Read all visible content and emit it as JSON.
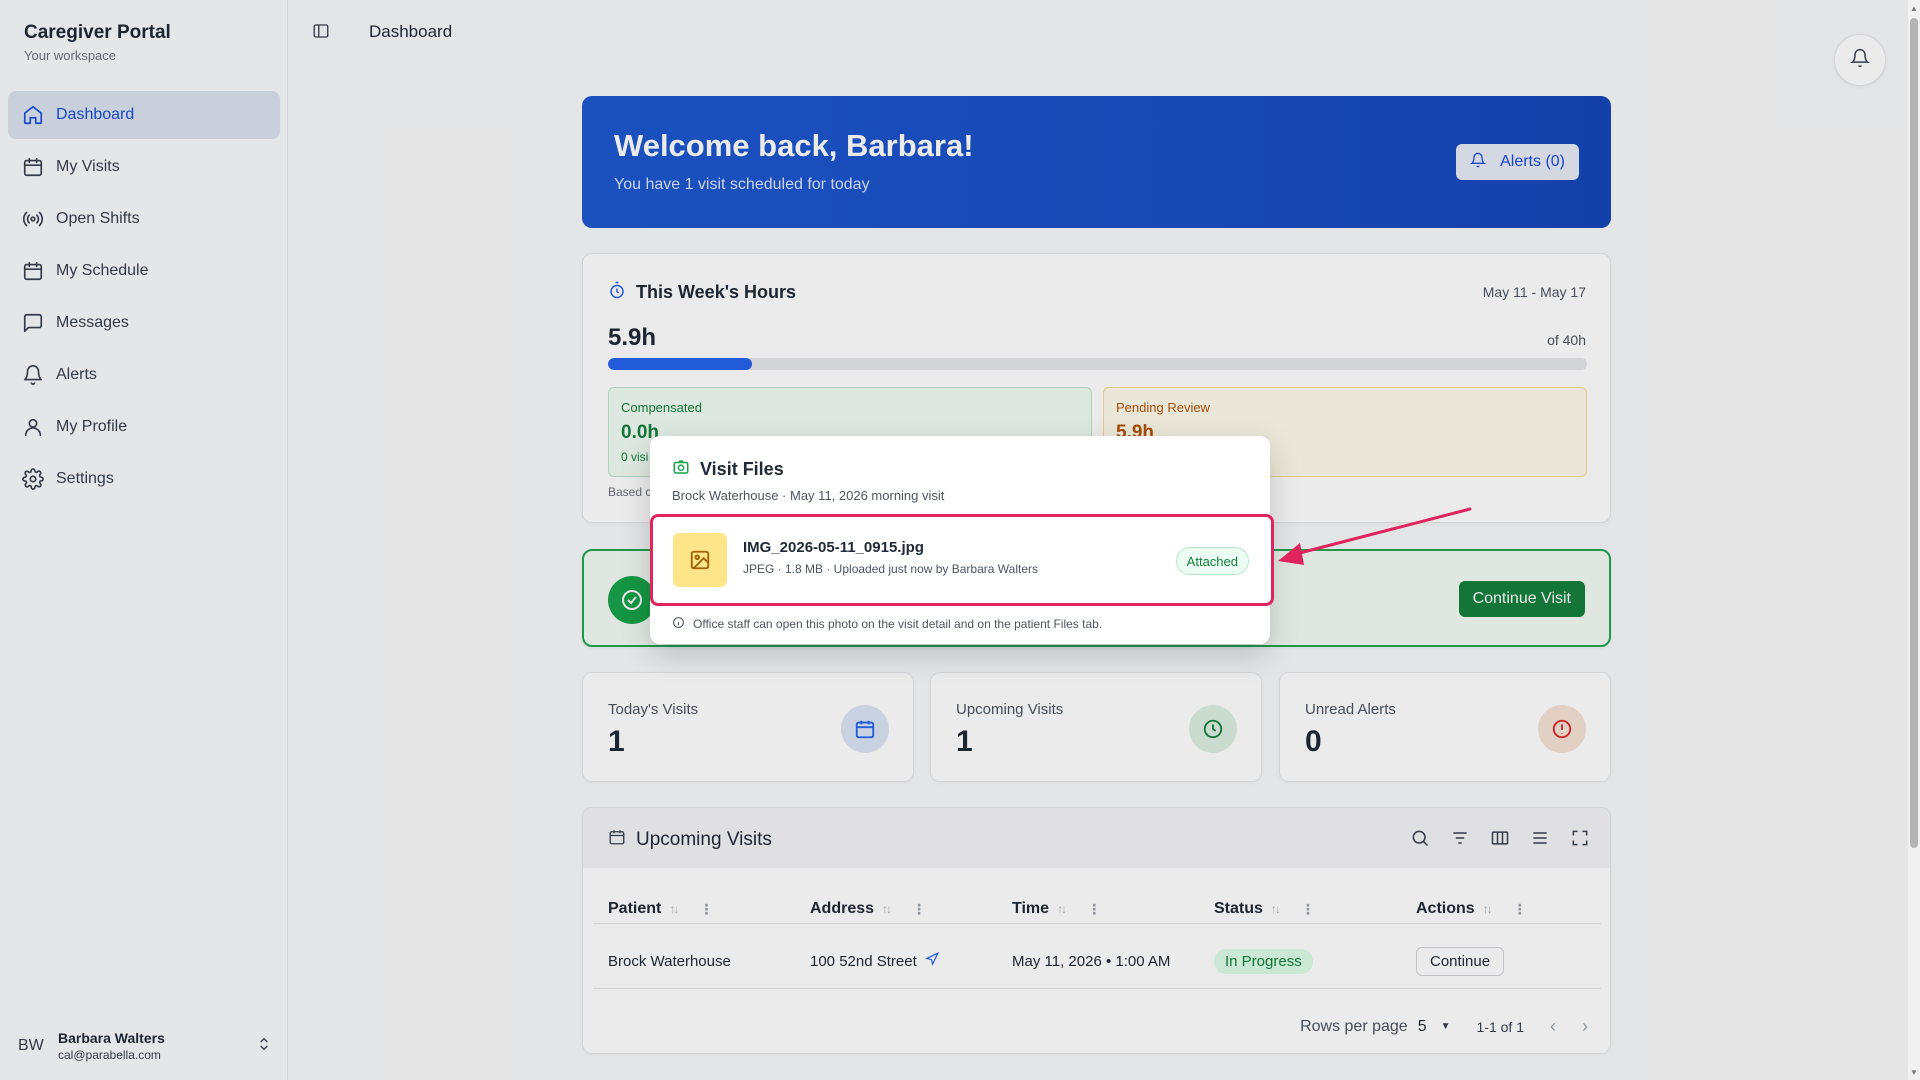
{
  "sidebar": {
    "brand_title": "Caregiver Portal",
    "brand_sub": "Your workspace",
    "items": [
      {
        "label": "Dashboard",
        "icon": "home-icon",
        "active": true
      },
      {
        "label": "My Visits",
        "icon": "calendar-icon"
      },
      {
        "label": "Open Shifts",
        "icon": "broadcast-icon"
      },
      {
        "label": "My Schedule",
        "icon": "calendar-icon"
      },
      {
        "label": "Messages",
        "icon": "message-icon"
      },
      {
        "label": "Alerts",
        "icon": "bell-icon"
      },
      {
        "label": "My Profile",
        "icon": "user-icon"
      },
      {
        "label": "Settings",
        "icon": "gear-icon"
      }
    ],
    "user": {
      "initials": "BW",
      "name": "Barbara Walters",
      "email": "cal@parabella.com"
    }
  },
  "header": {
    "title": "Dashboard"
  },
  "welcome": {
    "title": "Welcome back, Barbara!",
    "subtitle": "You have 1 visit scheduled for today",
    "alerts_label": "Alerts (0)"
  },
  "hours": {
    "title": "This Week's Hours",
    "range": "May 11 - May 17",
    "value": "5.9h",
    "of": "of 40h",
    "progress_fraction": 0.1475,
    "compensated_label": "Compensated",
    "compensated_value": "0.0h",
    "compensated_sub": "0 visi",
    "pending_label": "Pending Review",
    "pending_value": "5.9h",
    "based": "Based c"
  },
  "active_visit": {
    "continue_label": "Continue Visit"
  },
  "metrics": [
    {
      "label": "Today's Visits",
      "value": "1"
    },
    {
      "label": "Upcoming Visits",
      "value": "1"
    },
    {
      "label": "Unread Alerts",
      "value": "0"
    }
  ],
  "upcoming": {
    "title": "Upcoming Visits",
    "columns": [
      "Patient",
      "Address",
      "Time",
      "Status",
      "Actions"
    ],
    "rows": [
      {
        "patient": "Brock Waterhouse",
        "address": "100 52nd Street",
        "time": "May 11, 2026 • 1:00 AM",
        "status": "In Progress",
        "action": "Continue"
      }
    ],
    "rows_per_page_label": "Rows per page",
    "rows_per_page": "5",
    "range": "1-1 of 1"
  },
  "modal": {
    "title": "Visit Files",
    "subtitle": "Brock Waterhouse · May 11, 2026 morning visit",
    "file_name": "IMG_2026-05-11_0915.jpg",
    "file_meta": "JPEG · 1.8 MB · Uploaded just now by Barbara Walters",
    "badge": "Attached",
    "note": "Office staff can open this photo on the visit detail and on the patient Files tab."
  },
  "colors": {
    "accent": "#2563eb",
    "success": "#16a34a",
    "highlight": "#e0245e"
  }
}
